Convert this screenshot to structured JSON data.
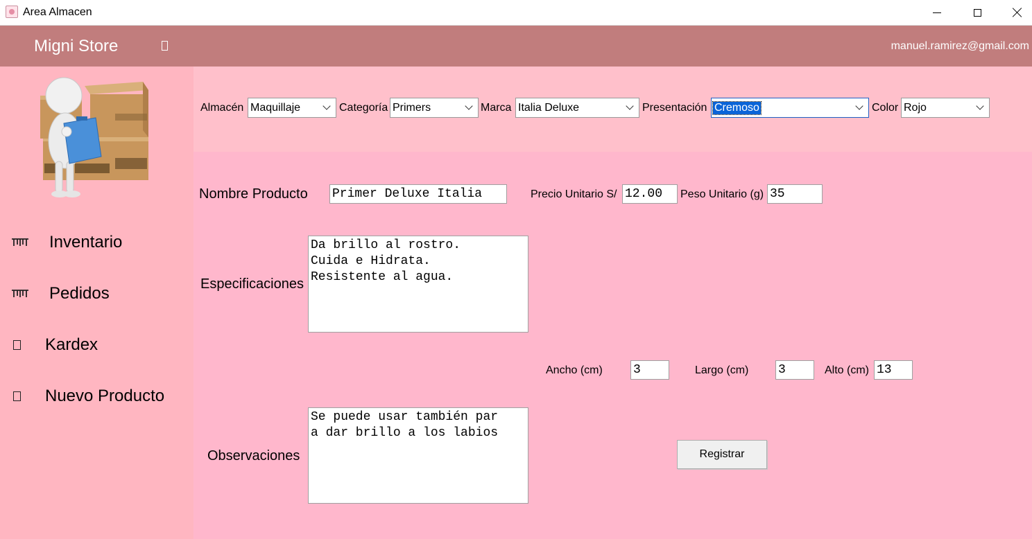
{
  "window": {
    "title": "Area Almacen"
  },
  "header": {
    "brand": "Migni Store",
    "user_email": "manuel.ramirez@gmail.com"
  },
  "sidebar": {
    "items": [
      {
        "label": "Inventario",
        "icon": "cart-icon"
      },
      {
        "label": "Pedidos",
        "icon": "cart-icon"
      },
      {
        "label": "Kardex",
        "icon": "square-icon"
      },
      {
        "label": "Nuevo Producto",
        "icon": "square-icon"
      }
    ]
  },
  "filters": {
    "almacen": {
      "label": "Almacén",
      "value": "Maquillaje"
    },
    "categoria": {
      "label": "Categoría",
      "value": "Primers"
    },
    "marca": {
      "label": "Marca",
      "value": "Italia Deluxe"
    },
    "presentacion": {
      "label": "Presentación",
      "value": "Cremoso"
    },
    "color": {
      "label": "Color",
      "value": "Rojo"
    }
  },
  "form": {
    "nombre": {
      "label": "Nombre Producto",
      "value": "Primer Deluxe Italia"
    },
    "precio": {
      "label": "Precio Unitario S/",
      "value": "12.00"
    },
    "peso": {
      "label": "Peso Unitario (g)",
      "value": "35"
    },
    "especificaciones": {
      "label": "Especificaciones",
      "value": "Da brillo al rostro.\nCuida e Hidrata.\nResistente al agua."
    },
    "ancho": {
      "label": "Ancho (cm)",
      "value": "3"
    },
    "largo": {
      "label": "Largo (cm)",
      "value": "3"
    },
    "alto": {
      "label": "Alto (cm)",
      "value": "13"
    },
    "observaciones": {
      "label": "Observaciones",
      "value": "Se puede usar también par\na dar brillo a los labios"
    },
    "submit_label": "Registrar"
  },
  "colors": {
    "header": "#c17d7d",
    "sidebar": "#ffb6c1",
    "filter_bar": "#ffc0cb",
    "form_bg": "#ffb7cc",
    "selection": "#0a64d8"
  }
}
